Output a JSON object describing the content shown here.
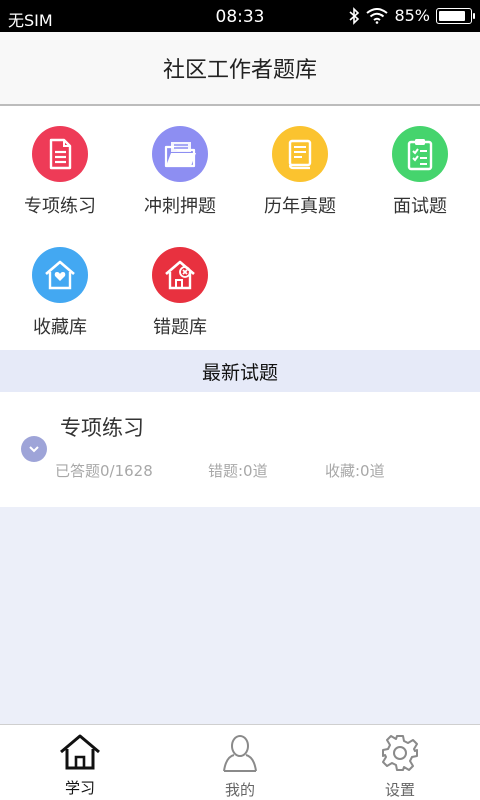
{
  "status_bar": {
    "carrier": "无SIM",
    "time": "08:33",
    "battery": "85%",
    "battery_level": 0.85
  },
  "header": {
    "title": "社区工作者题库"
  },
  "categories": [
    {
      "label": "专项练习",
      "icon": "document-icon",
      "color": "#ee3b57"
    },
    {
      "label": "冲刺押题",
      "icon": "folder-icon",
      "color": "#8d8ef2"
    },
    {
      "label": "历年真题",
      "icon": "book-icon",
      "color": "#fbc32f"
    },
    {
      "label": "面试题",
      "icon": "clipboard-check-icon",
      "color": "#45d46d"
    },
    {
      "label": "收藏库",
      "icon": "house-heart-icon",
      "color": "#43a8f2"
    },
    {
      "label": "错题库",
      "icon": "house-x-icon",
      "color": "#e8313f"
    }
  ],
  "latest": {
    "title": "最新试题",
    "item": {
      "name": "专项练习",
      "answered": "已答题0/1628",
      "wrong": "错题:0道",
      "favorites": "收藏:0道"
    }
  },
  "tabs": [
    {
      "label": "学习",
      "icon": "home-icon",
      "active": true
    },
    {
      "label": "我的",
      "icon": "person-icon",
      "active": false
    },
    {
      "label": "设置",
      "icon": "gear-icon",
      "active": false
    }
  ]
}
